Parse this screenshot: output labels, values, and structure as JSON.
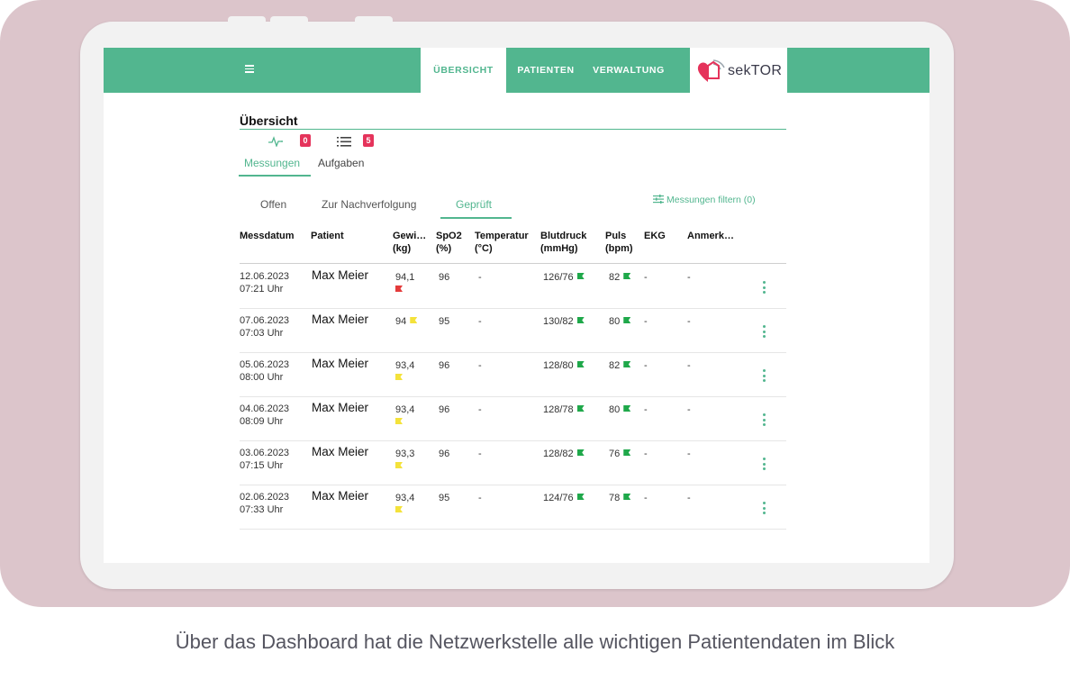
{
  "nav": {
    "items": [
      "ÜBERSICHT",
      "PATIENTEN",
      "VERWALTUNG"
    ],
    "active": "ÜBERSICHT",
    "logo_text": "sekTOR",
    "accent_color": "#52b68f"
  },
  "page": {
    "title": "Übersicht",
    "categories": [
      {
        "label": "Messungen",
        "icon": "pulse-icon",
        "count": "0"
      },
      {
        "label": "Aufgaben",
        "icon": "list-icon",
        "count": "5"
      }
    ],
    "subtabs": [
      "Offen",
      "Zur Nachverfolgung",
      "Geprüft"
    ],
    "active_subtab": "Geprüft",
    "filter_label": "Messungen filtern (0)"
  },
  "table": {
    "headers": {
      "messdatum": "Messdatum",
      "patient": "Patient",
      "gewicht_1": "Gewi…",
      "gewicht_2": "(kg)",
      "spo2_1": "SpO2",
      "spo2_2": "(%)",
      "temp_1": "Temperatur",
      "temp_2": "(°C)",
      "blut_1": "Blutdruck",
      "blut_2": "(mmHg)",
      "puls_1": "Puls",
      "puls_2": "(bpm)",
      "ekg": "EKG",
      "anmerk": "Anmerk…"
    },
    "rows": [
      {
        "date": "12.06.2023",
        "time": "07:21 Uhr",
        "patient": "Max Meier",
        "weight": "94,1",
        "weight_flag": "red",
        "spo2": "96",
        "temp": "-",
        "bp": "126/76",
        "bp_flag": "green",
        "pulse": "82",
        "pulse_flag": "green",
        "ekg": "-",
        "note": "-"
      },
      {
        "date": "07.06.2023",
        "time": "07:03 Uhr",
        "patient": "Max Meier",
        "weight": "94",
        "weight_flag": "yellow",
        "spo2": "95",
        "temp": "-",
        "bp": "130/82",
        "bp_flag": "green",
        "pulse": "80",
        "pulse_flag": "green",
        "ekg": "-",
        "note": "-"
      },
      {
        "date": "05.06.2023",
        "time": "08:00 Uhr",
        "patient": "Max Meier",
        "weight": "93,4",
        "weight_flag": "yellow",
        "spo2": "96",
        "temp": "-",
        "bp": "128/80",
        "bp_flag": "green",
        "pulse": "82",
        "pulse_flag": "green",
        "ekg": "-",
        "note": "-"
      },
      {
        "date": "04.06.2023",
        "time": "08:09 Uhr",
        "patient": "Max Meier",
        "weight": "93,4",
        "weight_flag": "yellow",
        "spo2": "96",
        "temp": "-",
        "bp": "128/78",
        "bp_flag": "green",
        "pulse": "80",
        "pulse_flag": "green",
        "ekg": "-",
        "note": "-"
      },
      {
        "date": "03.06.2023",
        "time": "07:15 Uhr",
        "patient": "Max Meier",
        "weight": "93,3",
        "weight_flag": "yellow",
        "spo2": "96",
        "temp": "-",
        "bp": "128/82",
        "bp_flag": "green",
        "pulse": "76",
        "pulse_flag": "green",
        "ekg": "-",
        "note": "-"
      },
      {
        "date": "02.06.2023",
        "time": "07:33 Uhr",
        "patient": "Max Meier",
        "weight": "93,4",
        "weight_flag": "yellow",
        "spo2": "95",
        "temp": "-",
        "bp": "124/76",
        "bp_flag": "green",
        "pulse": "78",
        "pulse_flag": "green",
        "ekg": "-",
        "note": "-"
      }
    ]
  },
  "caption": "Über das Dashboard hat die Netzwerkstelle alle wichtigen Patientendaten im Blick"
}
